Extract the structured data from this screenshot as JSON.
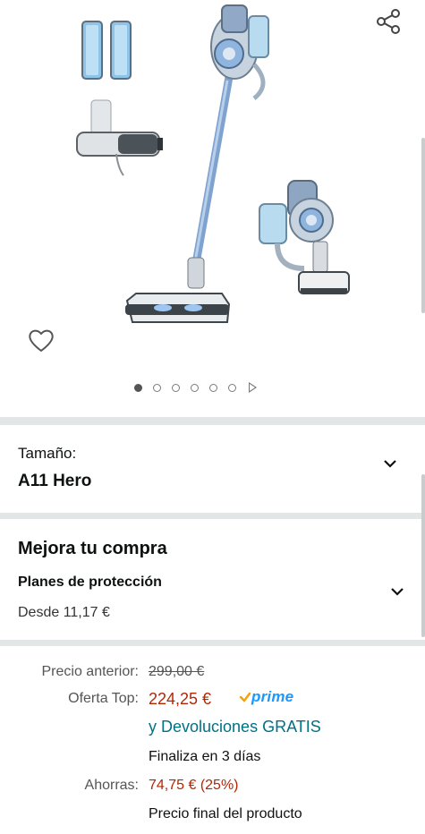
{
  "gallery": {
    "image_alt": "Aspiradora escoba sin cable A11 Hero con accesorios",
    "dots_total": 6,
    "dot_active_index": 0,
    "has_video": true
  },
  "icons": {
    "share": "share-icon",
    "wishlist": "heart-outline-icon",
    "chevron": "chevron-down-icon",
    "prime_check": "prime-check-icon"
  },
  "size": {
    "label": "Tamaño:",
    "value": "A11 Hero"
  },
  "protection": {
    "title": "Mejora tu compra",
    "subtitle": "Planes de protección",
    "price": "Desde 11,17 €"
  },
  "pricing": {
    "previous_label": "Precio anterior:",
    "previous_price": "299,00 €",
    "deal_label": "Oferta Top:",
    "deal_price": "224,25 €",
    "prime_text": "prime",
    "returns": "y Devoluciones GRATIS",
    "ends": "Finaliza en 3 días",
    "savings_label": "Ahorras:",
    "savings": "74,75 € (25%)",
    "final_note": "Precio final del producto"
  },
  "colors": {
    "accent_price": "#b12704",
    "link": "#007185",
    "prime": "#1a98ff",
    "separator": "#e3e6e6"
  }
}
